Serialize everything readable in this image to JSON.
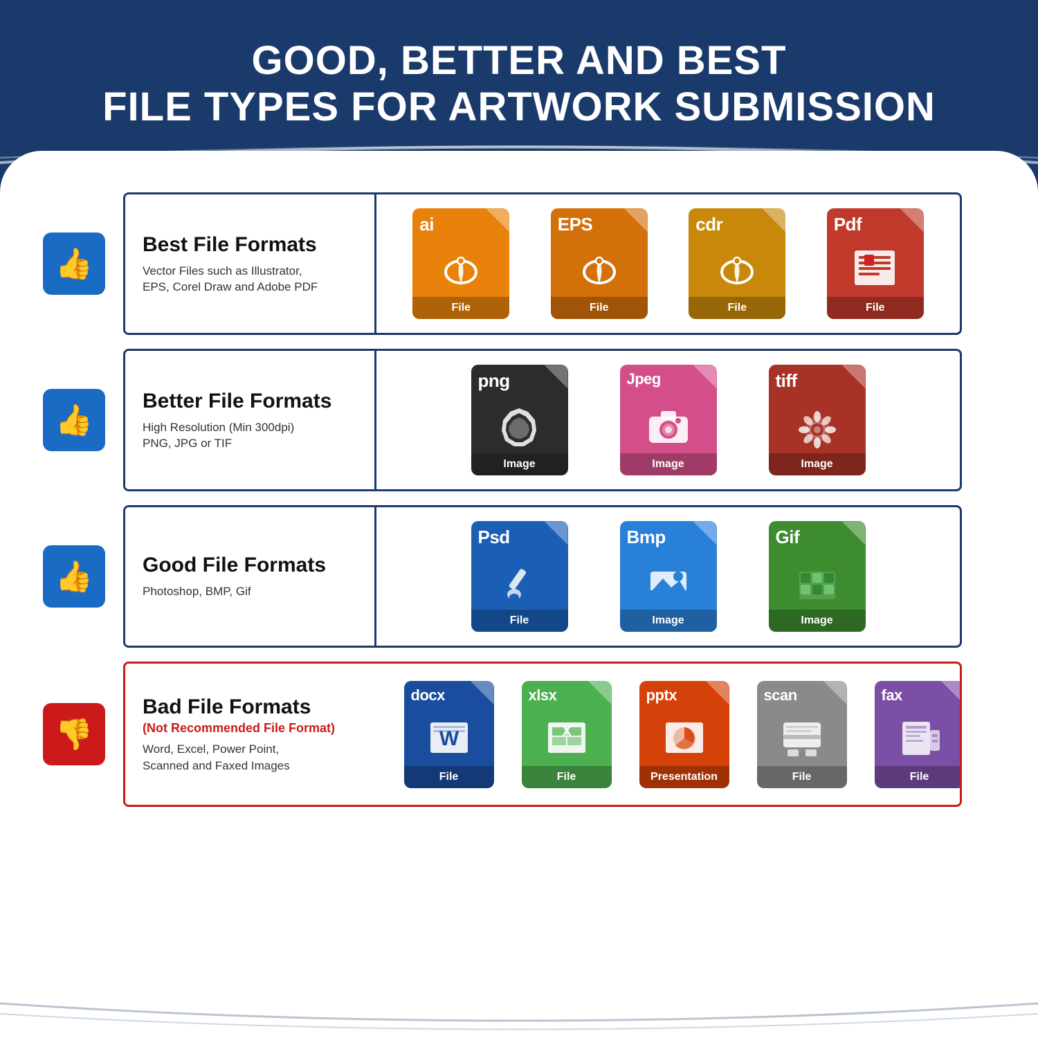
{
  "header": {
    "title_line1": "GOOD, BETTER AND BEST",
    "title_line2": "FILE TYPES FOR ARTWORK SUBMISSION"
  },
  "rows": [
    {
      "id": "best",
      "thumb": "👍",
      "thumbBad": false,
      "title": "Best File Formats",
      "subtitle": "",
      "description": "Vector Files such as Illustrator,\nEPS, Corel Draw and Adobe PDF",
      "borderColor": "#1a3a6b",
      "files": [
        {
          "ext": "ai",
          "label": "File",
          "color": "#e8820a",
          "icon": "pen",
          "iconType": "vector"
        },
        {
          "ext": "EPS",
          "label": "File",
          "color": "#d4700a",
          "icon": "pen",
          "iconType": "vector"
        },
        {
          "ext": "cdr",
          "label": "File",
          "color": "#c8880a",
          "icon": "pen",
          "iconType": "vector"
        },
        {
          "ext": "Pdf",
          "label": "File",
          "color": "#c0392b",
          "icon": "doc",
          "iconType": "doc"
        }
      ]
    },
    {
      "id": "better",
      "thumb": "👍",
      "thumbBad": false,
      "title": "Better File Formats",
      "subtitle": "",
      "description": "High Resolution (Min 300dpi)\nPNG, JPG or TIF",
      "borderColor": "#1a3a6b",
      "files": [
        {
          "ext": "png",
          "label": "Image",
          "color": "#2c2c2c",
          "icon": "star",
          "iconType": "star"
        },
        {
          "ext": "Jpeg",
          "label": "Image",
          "color": "#d44f8a",
          "icon": "camera",
          "iconType": "camera"
        },
        {
          "ext": "tiff",
          "label": "Image",
          "color": "#a93226",
          "icon": "gear",
          "iconType": "gear"
        }
      ]
    },
    {
      "id": "good",
      "thumb": "👍",
      "thumbBad": false,
      "title": "Good File Formats",
      "subtitle": "",
      "description": "Photoshop, BMP, Gif",
      "borderColor": "#1a3a6b",
      "files": [
        {
          "ext": "Psd",
          "label": "File",
          "color": "#1a5fb4",
          "icon": "brush",
          "iconType": "brush"
        },
        {
          "ext": "Bmp",
          "label": "Image",
          "color": "#2980d9",
          "icon": "landscape",
          "iconType": "landscape"
        },
        {
          "ext": "Gif",
          "label": "Image",
          "color": "#3d8c2f",
          "icon": "grid",
          "iconType": "grid"
        }
      ]
    },
    {
      "id": "bad",
      "thumb": "👎",
      "thumbBad": true,
      "title": "Bad File Formats",
      "subtitle": "(Not Recommended File Format)",
      "description": "Word, Excel, Power Point,\nScanned and Faxed Images",
      "borderColor": "#cc1a1a",
      "files": [
        {
          "ext": "docx",
          "label": "File",
          "color": "#1a4d9e",
          "icon": "W",
          "iconType": "letter"
        },
        {
          "ext": "xlsx",
          "label": "File",
          "color": "#4caf50",
          "icon": "X",
          "iconType": "letter"
        },
        {
          "ext": "pptx",
          "label": "Presentation",
          "color": "#d4420a",
          "icon": "chart",
          "iconType": "chart"
        },
        {
          "ext": "scan",
          "label": "File",
          "color": "#8a8a8a",
          "icon": "scanner",
          "iconType": "scanner"
        },
        {
          "ext": "fax",
          "label": "File",
          "color": "#7b4fa6",
          "icon": "fax",
          "iconType": "fax"
        }
      ]
    }
  ]
}
